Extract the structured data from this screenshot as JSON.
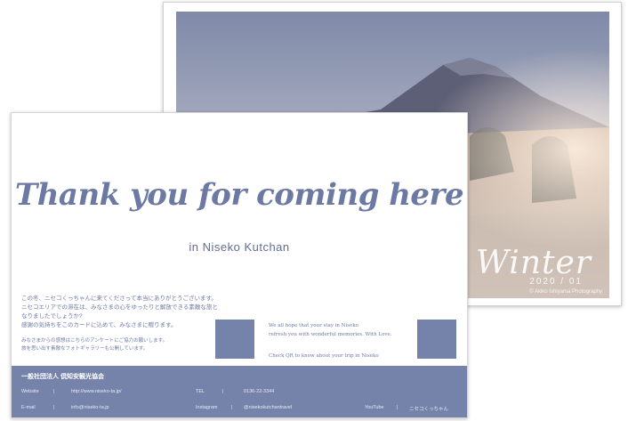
{
  "back_card": {
    "overlay_word": "Winter",
    "overlay_date": "2020 / 01",
    "overlay_credit": "© Akiko Ishiyama Photography"
  },
  "front_card": {
    "title": "Thank you for coming here",
    "subtitle": "in  Niseko Kutchan",
    "jp_lines": [
      "この冬、ニセコくっちゃんに来てくださって本当にありがとうございます。",
      "ニセコエリアでの滞在は、みなさまの心をゆったりと解放できる素敵な旅と",
      "なりましたでしょうか?",
      "感謝の気持ちをこのカードに込めて、みなさまに贈ります。"
    ],
    "jp_small_lines": [
      "みなさまからの感想はこちらのアンケートにご協力お願いします。",
      "旅を思い出す素敵なフォトギャラリーも公開しています。"
    ],
    "en_lines": [
      "We all hope that your stay in Niseko",
      "refresh you with wonderful memories. With Love.",
      "Check QR to know about your trip in Niseko"
    ],
    "footer": {
      "org": "一般社団法人 倶知安観光協会",
      "website_label": "Website",
      "website_value": "http://www.niseko-ta.jp/",
      "tel_label": "TEL",
      "tel_value": "0136-22-3344",
      "email_label": "E-mail",
      "email_value": "info@niseko-ta.jp",
      "instagram_label": "Instagram",
      "instagram_value": "@nisekokutchantravel",
      "youtube_label": "YouTube",
      "youtube_value": "ニセコくっちゃん"
    }
  },
  "colors": {
    "accent": "#6b79a3",
    "footer_bg": "#7582a9"
  }
}
